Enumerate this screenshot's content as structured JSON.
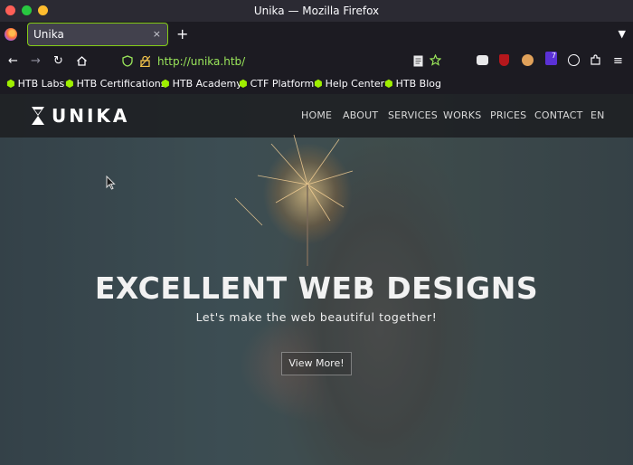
{
  "window": {
    "title": "Unika — Mozilla Firefox",
    "traffic_colors": [
      "#ff5f57",
      "#28c840",
      "#febc2e"
    ]
  },
  "tab": {
    "label": "Unika",
    "close": "×"
  },
  "newtab_symbol": "+",
  "address": {
    "url": "http://unika.htb/"
  },
  "bookmarks": [
    {
      "label": "HTB Labs"
    },
    {
      "label": "HTB Certifications"
    },
    {
      "label": "HTB Academy"
    },
    {
      "label": "CTF Platform"
    },
    {
      "label": "Help Center"
    },
    {
      "label": "HTB Blog"
    }
  ],
  "toolbar_badges": {
    "extension_count": "7"
  },
  "site": {
    "brand": "UNIKA",
    "menu": [
      "HOME",
      "ABOUT",
      "SERVICES",
      "WORKS",
      "PRICES",
      "CONTACT",
      "EN"
    ],
    "hero": {
      "headline": "EXCELLENT WEB DESIGNS",
      "tagline": "Let's make the web beautiful together!",
      "cta": "View More!"
    }
  },
  "colors": {
    "accent": "#84cc16",
    "url_text": "#9ae65a",
    "htb_green": "#9fef00",
    "chrome_bg": "#1c1b22"
  }
}
